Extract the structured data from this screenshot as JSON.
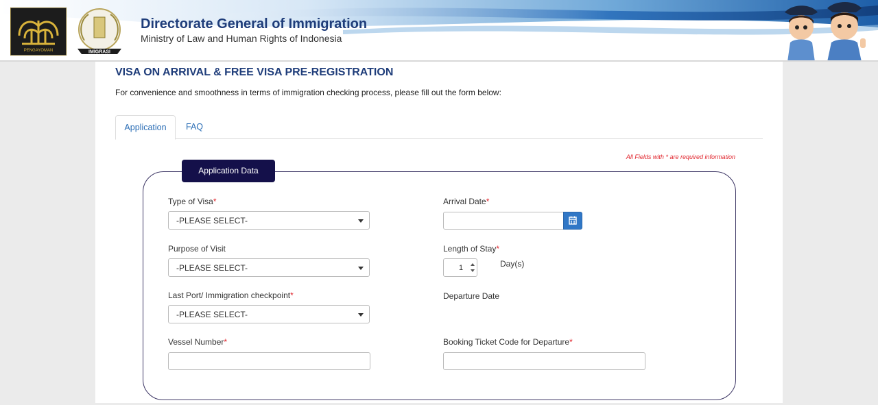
{
  "header": {
    "title": "Directorate General of Immigration",
    "subtitle": "Ministry of Law and Human Rights of Indonesia",
    "logo1_text": "PENGAYOMAN",
    "logo2_text": "IMIGRASI"
  },
  "page": {
    "title": "VISA ON ARRIVAL & FREE VISA PRE-REGISTRATION",
    "intro": "For convenience and smoothness in terms of immigration checking process, please fill out the form below:"
  },
  "tabs": [
    {
      "label": "Application",
      "active": true
    },
    {
      "label": "FAQ",
      "active": false
    }
  ],
  "required_note": "All Fields with * are required information",
  "legend": "Application Data",
  "form": {
    "type_of_visa": {
      "label": "Type of Visa",
      "required": "*",
      "value": "-PLEASE SELECT-"
    },
    "purpose_of_visit": {
      "label": "Purpose of Visit",
      "value": "-PLEASE SELECT-"
    },
    "last_port": {
      "label": "Last Port/ Immigration checkpoint",
      "required": "*",
      "value": "-PLEASE SELECT-"
    },
    "vessel_number": {
      "label": "Vessel Number",
      "required": "*",
      "value": ""
    },
    "arrival_date": {
      "label": "Arrival Date",
      "required": "*",
      "value": ""
    },
    "length_of_stay": {
      "label": "Length of Stay",
      "required": "*",
      "value": "1",
      "unit": "Day(s)"
    },
    "departure_date": {
      "label": "Departure Date"
    },
    "booking_code": {
      "label": "Booking Ticket Code for Departure",
      "required": "*",
      "value": ""
    }
  },
  "icons": {
    "calendar": "calendar-icon",
    "dropdown": "chevron-down-icon"
  },
  "colors": {
    "title_blue": "#1f3d7a",
    "legend_bg": "#14104a",
    "required_red": "#e0222a",
    "button_blue": "#3077c6"
  }
}
